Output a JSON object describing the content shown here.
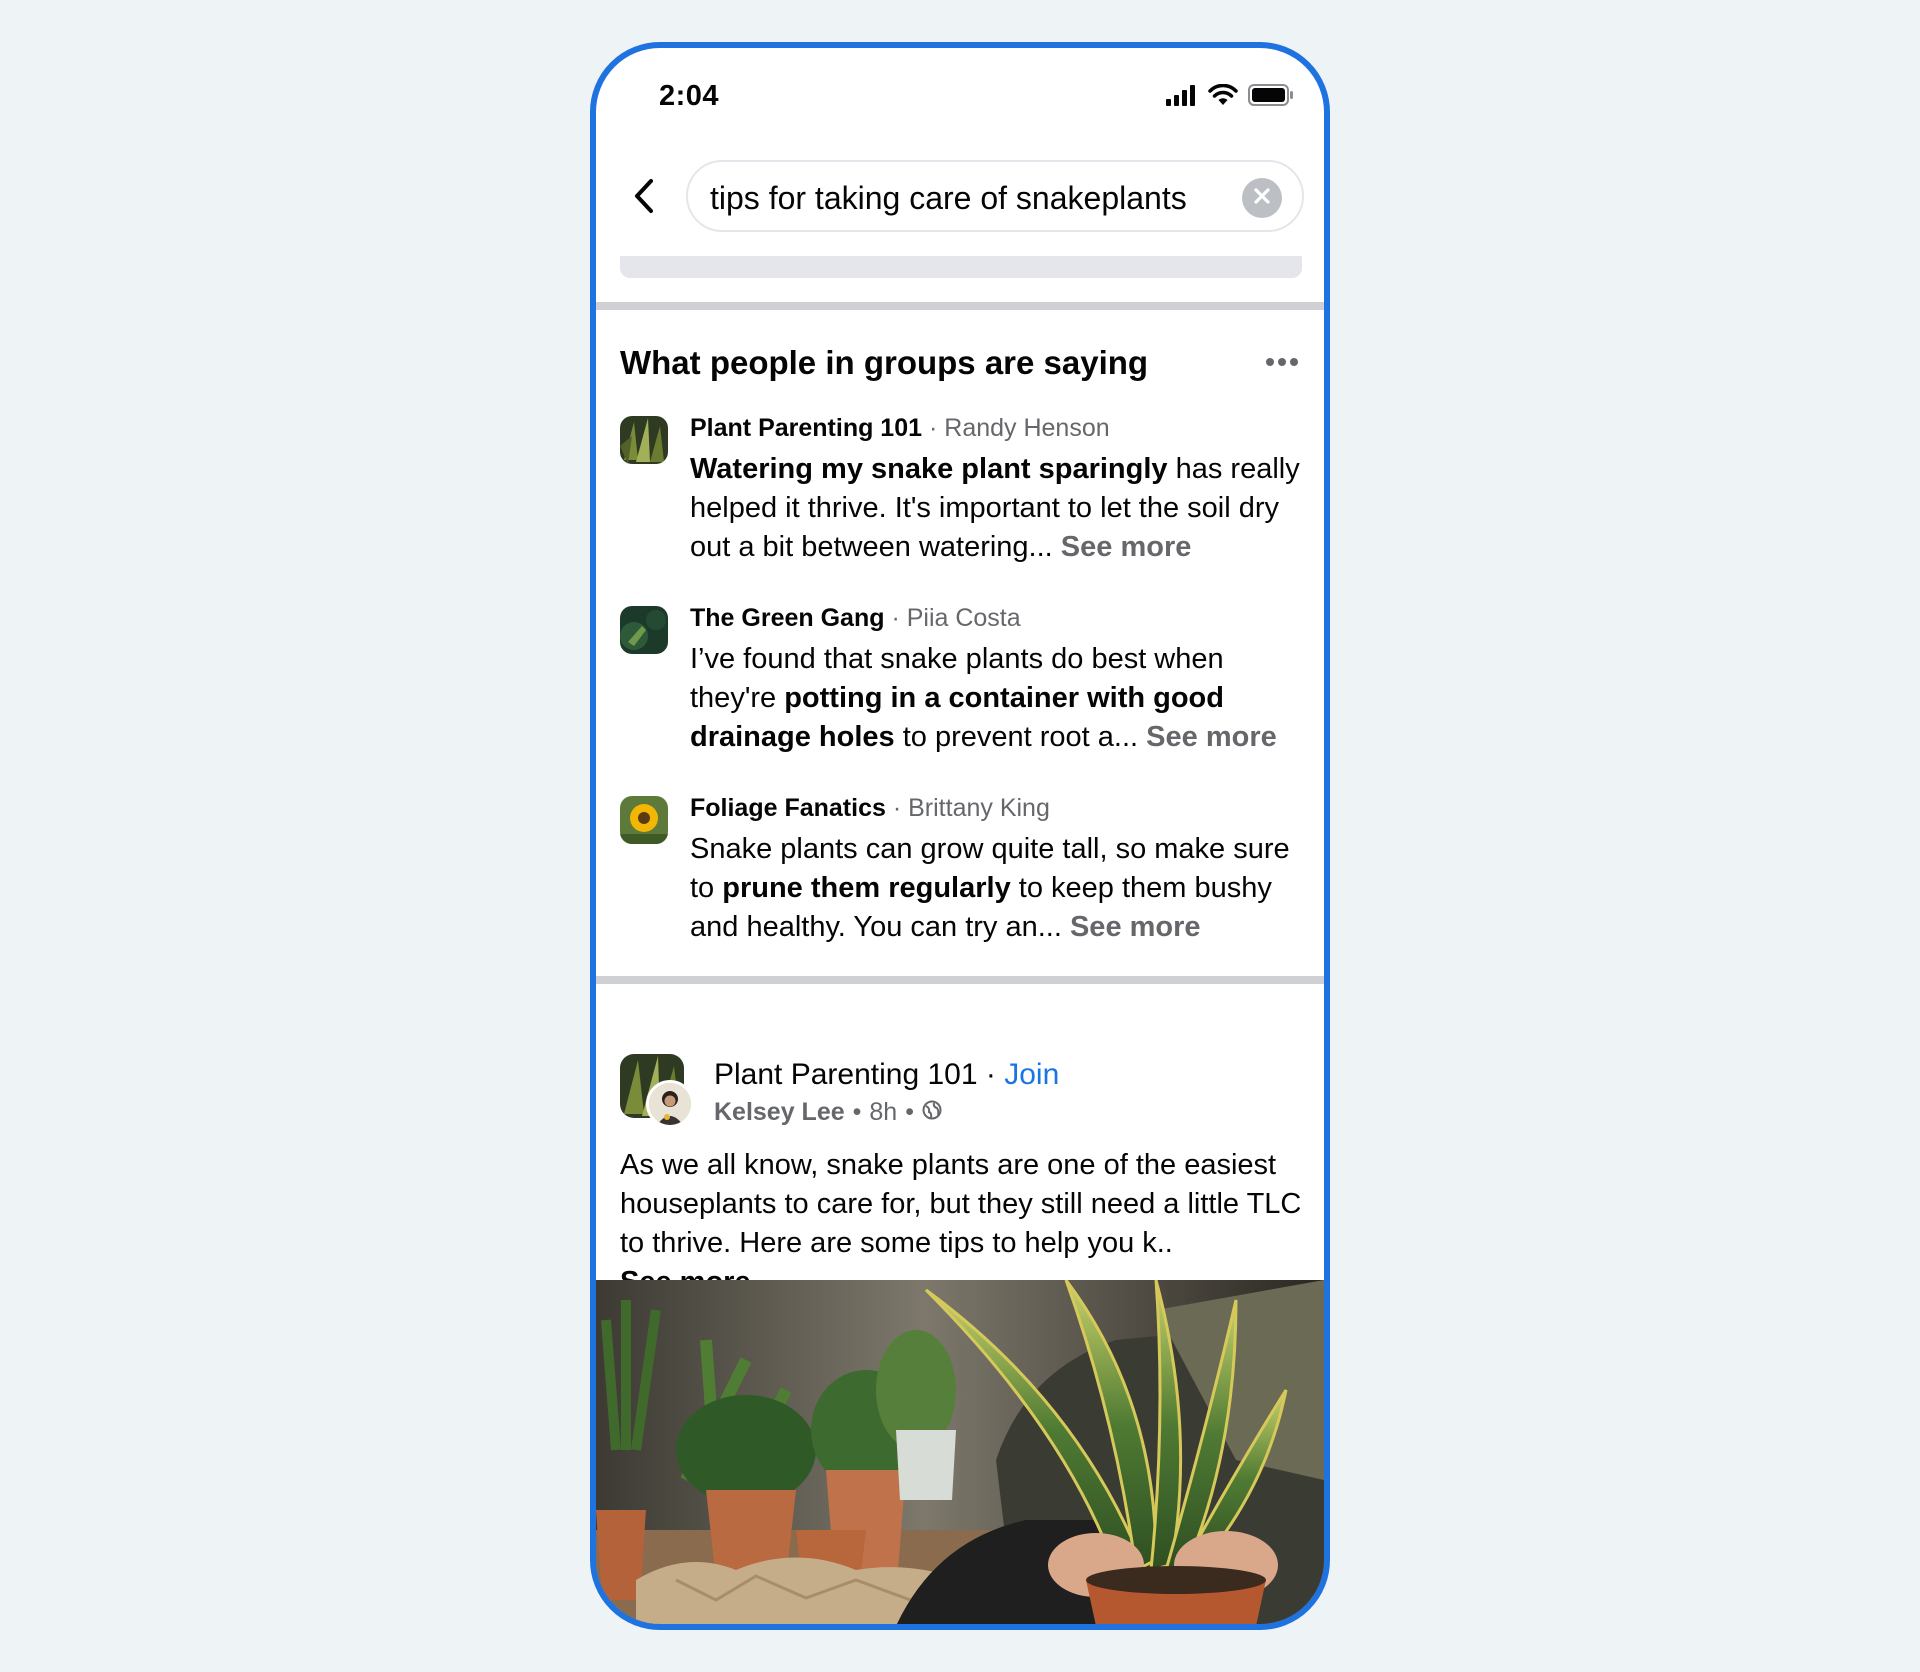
{
  "status_bar": {
    "time": "2:04",
    "icons": [
      "signal-icon",
      "wifi-icon",
      "battery-icon"
    ]
  },
  "search": {
    "query": "tips for taking care of snakeplants",
    "back_icon": "back-arrow-icon",
    "clear_icon": "clear-icon"
  },
  "groups_section": {
    "title": "What people in groups are saying",
    "more_icon": "more-options-icon",
    "snippets": [
      {
        "group": "Plant Parenting 101",
        "separator": "·",
        "author": "Randy Henson",
        "bold_lead": "Watering my snake plant sparingly",
        "text_after": " has really helped it thrive. It's important to let the soil dry out a bit between watering... ",
        "see_more": "See more"
      },
      {
        "group": "The Green Gang",
        "separator": "·",
        "author": "Piia Costa",
        "text_before": "I’ve found that snake plants do best when they're ",
        "bold_mid": "potting in a container with good drainage holes",
        "text_after": " to prevent root a... ",
        "see_more": "See more"
      },
      {
        "group": "Foliage Fanatics",
        "separator": "·",
        "author": "Brittany King",
        "text_before": "Snake plants can grow quite tall, so make sure to ",
        "bold_mid": "prune them regularly",
        "text_after": " to keep them bushy and healthy. You can try an... ",
        "see_more": "See more"
      }
    ]
  },
  "post": {
    "group": "Plant Parenting 101",
    "dot": "·",
    "join_label": "Join",
    "author": "Kelsey Lee",
    "bullet": "•",
    "time": "8h",
    "privacy_icon": "globe-icon",
    "body": "As we all know, snake plants are one of the easiest houseplants to care for, but they still need a little TLC to thrive. Here are some tips to help you k..",
    "see_more": "See more"
  },
  "colors": {
    "accent": "#1f73e0",
    "link": "#1b74e4",
    "secondary_text": "#65676b",
    "divider": "#ced0d4",
    "background": "#eef3f6"
  }
}
